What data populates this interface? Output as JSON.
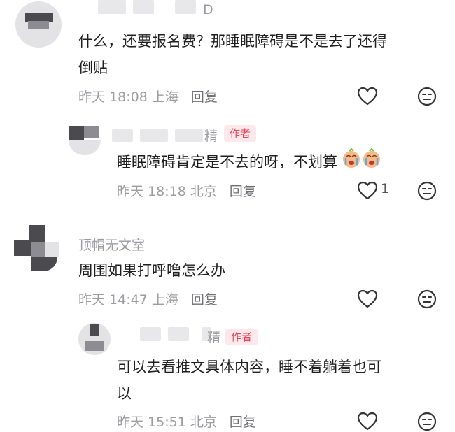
{
  "comments": [
    {
      "username": "D",
      "text_line1": "什么，还要报名费？那睡眠障碍是不是去了还得",
      "text_line2": "倒贴",
      "meta_time": "昨天 18:08 上海",
      "reply_label": "回复",
      "reply": {
        "username": "精",
        "author_tag": "作者",
        "text": "睡眠障碍肯定是不去的呀，不划算",
        "meta_time": "昨天 18:18 北京",
        "reply_label": "回复",
        "like_count": "1"
      }
    },
    {
      "username": "顶帽无文室",
      "text_line1": "周围如果打呼噜怎么办",
      "meta_time": "昨天 14:47 上海",
      "reply_label": "回复",
      "reply": {
        "username": "精",
        "author_tag": "作者",
        "text_line1": "可以去看推文具体内容，睡不着躺着也可",
        "text_line2": "以",
        "meta_time": "昨天 15:51 北京",
        "reply_label": "回复"
      }
    }
  ],
  "icons": {
    "like": "heart-outline-icon",
    "dislike": "neutral-face-icon",
    "emoji": "crying-face-emoji"
  },
  "colors": {
    "author_tag_text": "#e0455a",
    "author_tag_bg": "#fde9ec",
    "meta_gray": "#9c9ca2"
  }
}
